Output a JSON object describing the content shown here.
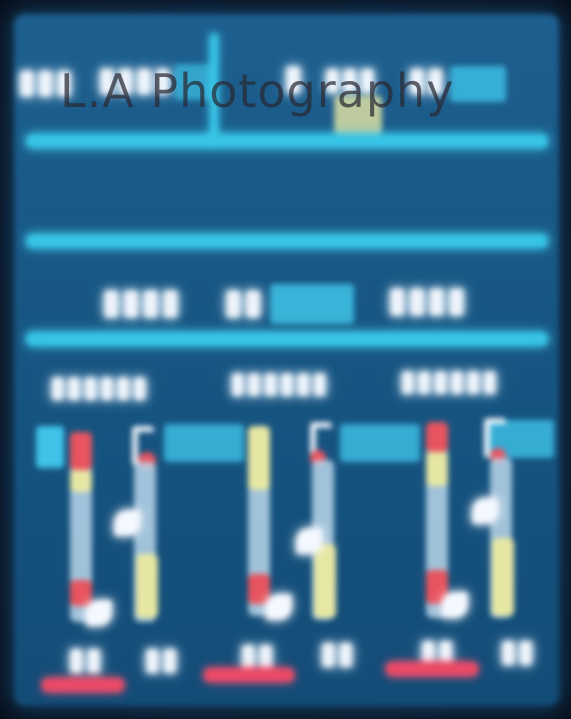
{
  "watermark": {
    "text": "L.A Photography"
  },
  "colors": {
    "screen": "#175683",
    "accent": "#37c4e6",
    "red": "#e8545f",
    "yellow": "#e7e7a4"
  }
}
